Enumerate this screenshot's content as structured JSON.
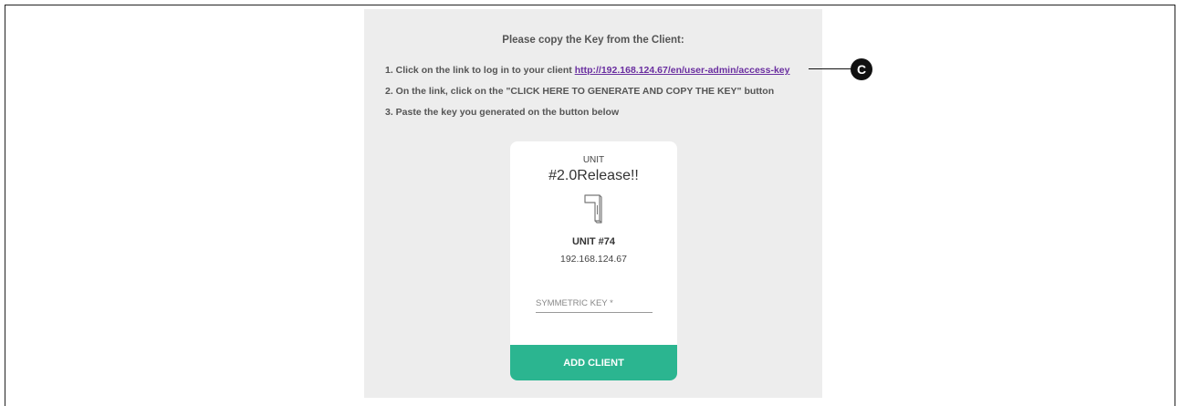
{
  "instructions": {
    "heading": "Please copy the Key from the Client:",
    "step1_text": "1. Click on the link to log in to your client ",
    "step1_link": "http://192.168.124.67/en/user-admin/access-key",
    "step2_text": "2. On the link, click on the \"CLICK HERE TO GENERATE AND COPY THE KEY\" button",
    "step3_text": "3. Paste the key you generated on the button below"
  },
  "card": {
    "unit_label": "UNIT",
    "unit_name": "#2.0Release!!",
    "device_icon": "device-icon",
    "unit_number": "UNIT #74",
    "unit_ip": "192.168.124.67",
    "key_input": {
      "value": "",
      "placeholder": "SYMMETRIC KEY *"
    },
    "add_button_label": "ADD CLIENT"
  },
  "callout": {
    "label": "C"
  },
  "colors": {
    "panel_bg": "#ededed",
    "button_bg": "#2bb590",
    "link": "#6a2fa0"
  }
}
